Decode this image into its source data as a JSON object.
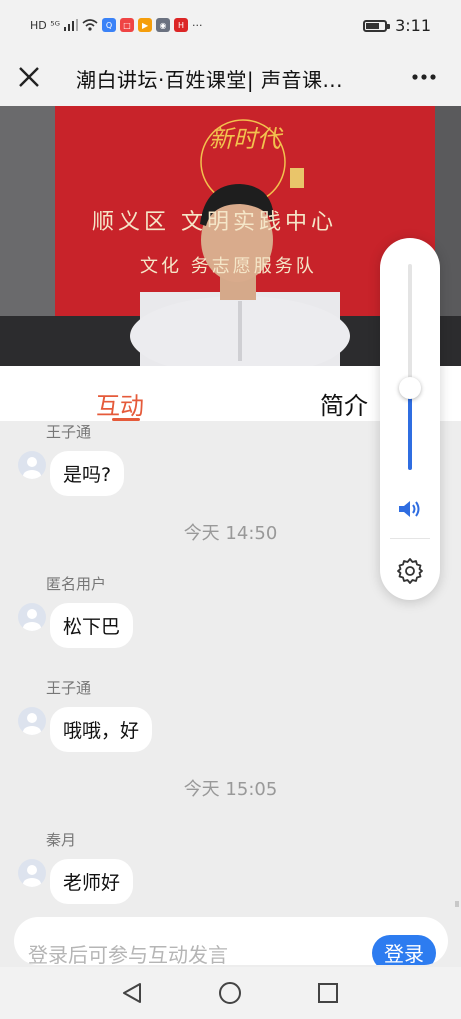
{
  "status_bar": {
    "left_text": "HD ⁵ᴳ",
    "time": "3:11",
    "battery_level": 0.72,
    "app_icon_colors": [
      "#3a82f7",
      "#ef4444",
      "#f59e0b",
      "#6b7280",
      "#dc2626"
    ]
  },
  "titlebar": {
    "title": "潮白讲坛·百姓课堂| 声音课...",
    "close_icon": "close-icon",
    "more_icon": "more-icon"
  },
  "video": {
    "banner_line1": "顺义区 文明实践中心",
    "banner_line2": "文化 务志愿服务队",
    "emblem_text": "新时代"
  },
  "tabs": {
    "active": "互动",
    "intro": "简介"
  },
  "chat": {
    "messages": [
      {
        "type": "msg",
        "name": "王子通",
        "text": "是吗?"
      },
      {
        "type": "time",
        "text": "今天 14:50"
      },
      {
        "type": "msg",
        "name": "匿名用户",
        "text": "松下巴"
      },
      {
        "type": "msg",
        "name": "王子通",
        "text": "哦哦，好"
      },
      {
        "type": "time",
        "text": "今天 15:05"
      },
      {
        "type": "msg",
        "name": "秦月",
        "text": "老师好"
      }
    ]
  },
  "volume": {
    "level": 0.4,
    "speaker_icon": "speaker-icon",
    "settings_icon": "gear-icon"
  },
  "input": {
    "placeholder": "登录后可参与互动发言",
    "login_label": "登录"
  },
  "navbar": {
    "back_icon": "back-triangle-icon",
    "home_icon": "home-circle-icon",
    "recent_icon": "recent-square-icon"
  },
  "colors": {
    "accent": "#e55a3a",
    "brand_blue": "#2d7cf0",
    "volume_blue": "#2f6de1",
    "banner_red": "#c8232a"
  }
}
